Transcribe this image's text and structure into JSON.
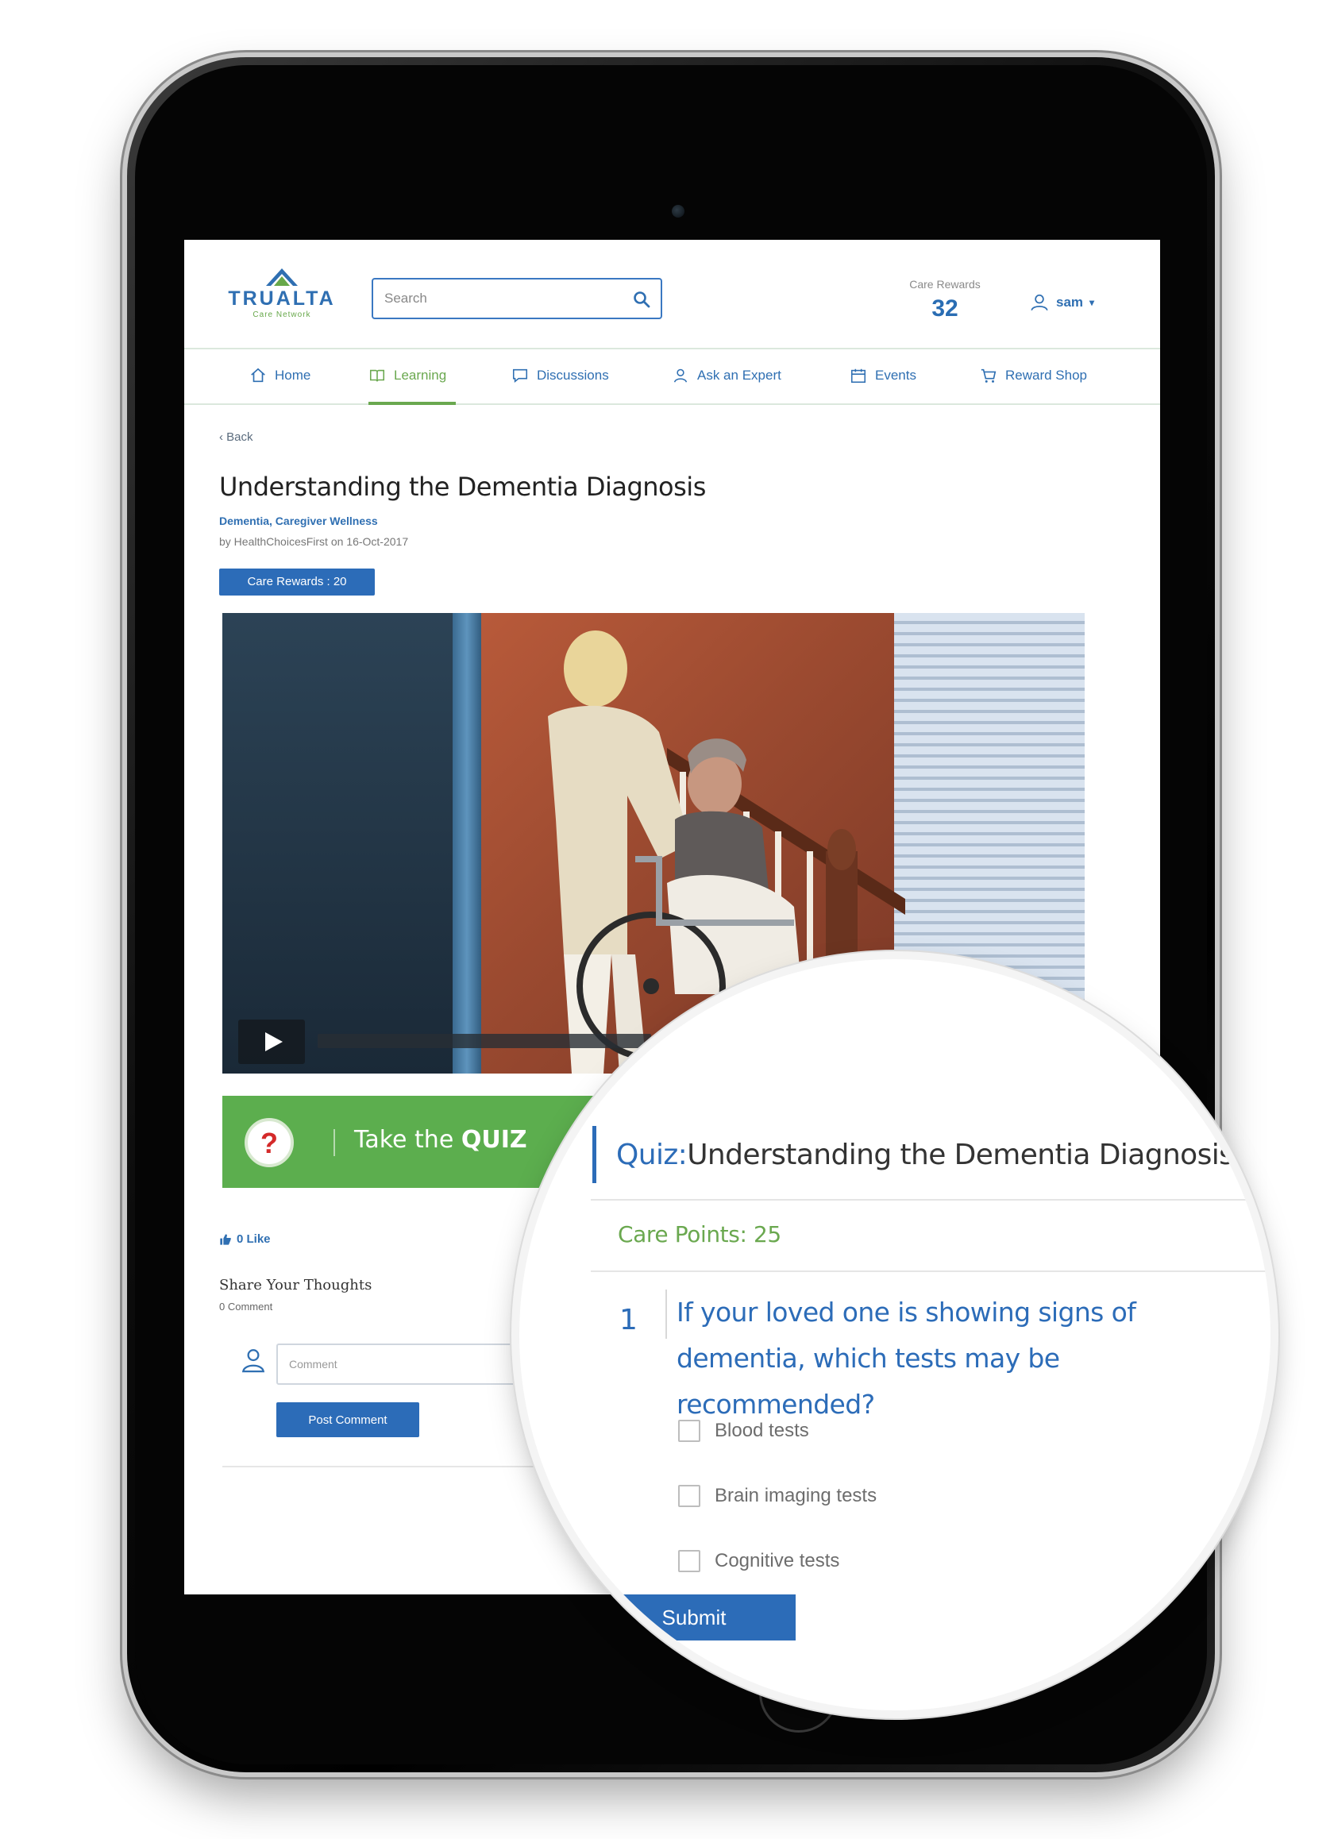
{
  "header": {
    "logo": {
      "name": "TRUALTA",
      "tagline": "Care Network"
    },
    "search": {
      "placeholder": "Search",
      "value": ""
    },
    "care_rewards": {
      "label": "Care Rewards",
      "value": "32"
    },
    "user": {
      "name": "sam"
    }
  },
  "nav": {
    "items": [
      {
        "label": "Home",
        "icon": "home-icon"
      },
      {
        "label": "Learning",
        "icon": "book-icon",
        "active": true
      },
      {
        "label": "Discussions",
        "icon": "chat-icon"
      },
      {
        "label": "Ask an Expert",
        "icon": "person-icon"
      },
      {
        "label": "Events",
        "icon": "calendar-icon"
      },
      {
        "label": "Reward Shop",
        "icon": "cart-icon"
      }
    ]
  },
  "article": {
    "back": "‹ Back",
    "title": "Understanding the Dementia Diagnosis",
    "categories": "Dementia, Caregiver Wellness",
    "byline": "by HealthChoicesFirst on 16-Oct-2017",
    "rewards_badge": "Care Rewards : 20"
  },
  "quiz_banner": {
    "question_mark": "?",
    "take": "Take the",
    "quiz": "QUIZ"
  },
  "engagement": {
    "like": "0 Like",
    "share_title": "Share Your Thoughts",
    "comment_count": "0 Comment",
    "comment_placeholder": "Comment",
    "post_comment": "Post Comment"
  },
  "quiz_zoom": {
    "title_prefix": "Quiz:",
    "title": "Understanding the Dementia Diagnosis",
    "care_points": "Care Points: 25",
    "question_number": "1",
    "question": "If your loved one is showing signs of dementia, which tests may be recommended?",
    "options": [
      "Blood tests",
      "Brain imaging tests",
      "Cognitive tests"
    ],
    "submit": "Submit"
  },
  "colors": {
    "brand_blue": "#2c6cb8",
    "brand_green": "#5cae4e",
    "quiz_red": "#d42a2a"
  }
}
